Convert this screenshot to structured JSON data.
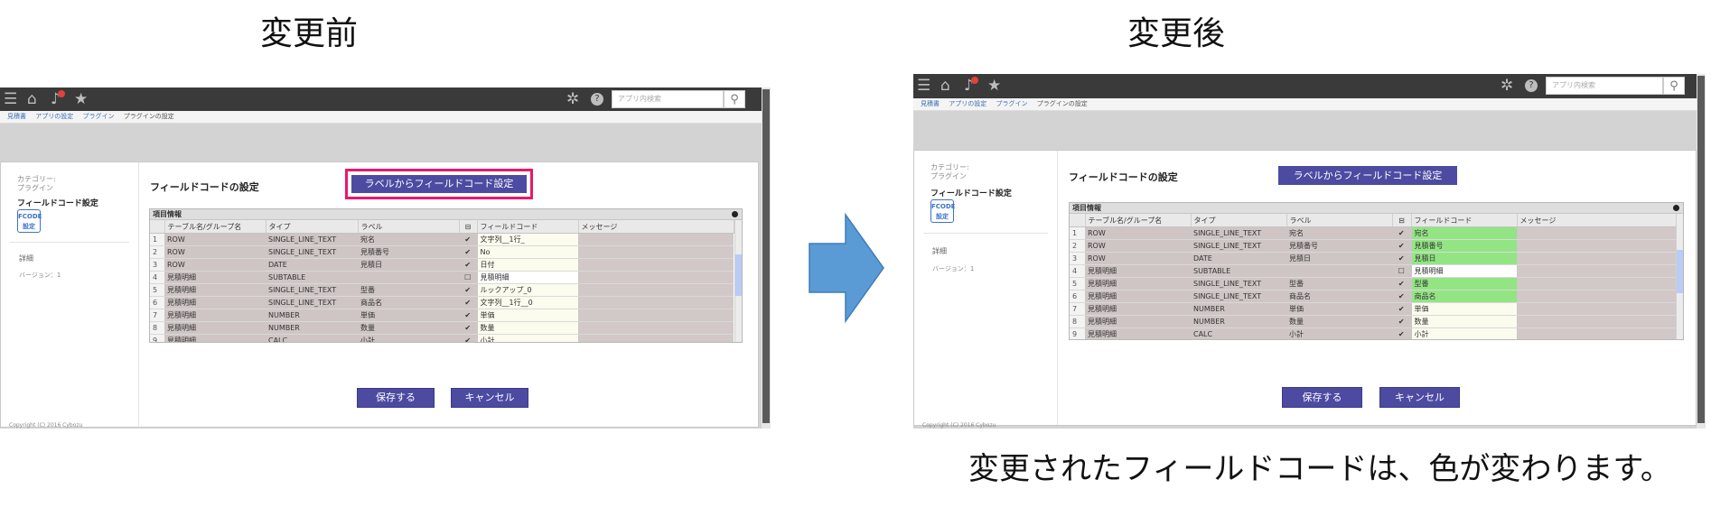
{
  "headings": {
    "before": "変更前",
    "after": "変更後"
  },
  "caption": "変更されたフィールドコードは、色が変わります。",
  "arrow": {
    "icon": "right-arrow",
    "color": "#5b9bd5"
  },
  "colors": {
    "changed_code": "#93e584",
    "highlight_outline": "#e8186d",
    "button": "#4c4ba1"
  },
  "app": {
    "search_placeholder": "アプリ内検索",
    "icons": [
      "menu-icon",
      "home-icon",
      "bell-icon",
      "star-icon",
      "gear-icon",
      "help-icon",
      "search-icon"
    ],
    "breadcrumb": [
      "見積書",
      "アプリの設定",
      "プラグイン",
      "プラグインの設定"
    ],
    "sidebar": {
      "category_label": "カテゴリー:",
      "category_value": "プラグイン",
      "title": "フィールドコード設定",
      "logo_line1": "FCODE",
      "logo_line2": "設定",
      "details": "詳細",
      "version": "バージョン：1"
    },
    "section_title": "フィールドコードの設定",
    "label_button": "ラベルからフィールドコード設定",
    "grid_title": "項目情報",
    "columns": [
      "",
      "テーブル名/グループ名",
      "タイプ",
      "ラベル",
      "⊟",
      "フィールドコード",
      "メッセージ"
    ],
    "rows_before": [
      {
        "no": "1",
        "table": "ROW",
        "type": "SINGLE_LINE_TEXT",
        "label": "宛名",
        "checked": true,
        "code": "文字列__1行_",
        "style": ""
      },
      {
        "no": "2",
        "table": "ROW",
        "type": "SINGLE_LINE_TEXT",
        "label": "見積番号",
        "checked": true,
        "code": "No",
        "style": ""
      },
      {
        "no": "3",
        "table": "ROW",
        "type": "DATE",
        "label": "見積日",
        "checked": true,
        "code": "日付",
        "style": ""
      },
      {
        "no": "4",
        "table": "見積明細",
        "type": "SUBTABLE",
        "label": "",
        "checked": false,
        "code": "見積明細",
        "style": "white"
      },
      {
        "no": "5",
        "table": "見積明細",
        "type": "SINGLE_LINE_TEXT",
        "label": "型番",
        "checked": true,
        "code": "ルックアップ_0",
        "style": ""
      },
      {
        "no": "6",
        "table": "見積明細",
        "type": "SINGLE_LINE_TEXT",
        "label": "商品名",
        "checked": true,
        "code": "文字列__1行__0",
        "style": ""
      },
      {
        "no": "7",
        "table": "見積明細",
        "type": "NUMBER",
        "label": "単価",
        "checked": true,
        "code": "単価",
        "style": ""
      },
      {
        "no": "8",
        "table": "見積明細",
        "type": "NUMBER",
        "label": "数量",
        "checked": true,
        "code": "数量",
        "style": ""
      },
      {
        "no": "9",
        "table": "見積明細",
        "type": "CALC",
        "label": "小計",
        "checked": true,
        "code": "小計",
        "style": ""
      }
    ],
    "rows_after": [
      {
        "no": "1",
        "table": "ROW",
        "type": "SINGLE_LINE_TEXT",
        "label": "宛名",
        "checked": true,
        "code": "宛名",
        "style": "changed"
      },
      {
        "no": "2",
        "table": "ROW",
        "type": "SINGLE_LINE_TEXT",
        "label": "見積番号",
        "checked": true,
        "code": "見積番号",
        "style": "changed"
      },
      {
        "no": "3",
        "table": "ROW",
        "type": "DATE",
        "label": "見積日",
        "checked": true,
        "code": "見積日",
        "style": "changed"
      },
      {
        "no": "4",
        "table": "見積明細",
        "type": "SUBTABLE",
        "label": "",
        "checked": false,
        "code": "見積明細",
        "style": "white"
      },
      {
        "no": "5",
        "table": "見積明細",
        "type": "SINGLE_LINE_TEXT",
        "label": "型番",
        "checked": true,
        "code": "型番",
        "style": "changed"
      },
      {
        "no": "6",
        "table": "見積明細",
        "type": "SINGLE_LINE_TEXT",
        "label": "商品名",
        "checked": true,
        "code": "商品名",
        "style": "changed"
      },
      {
        "no": "7",
        "table": "見積明細",
        "type": "NUMBER",
        "label": "単価",
        "checked": true,
        "code": "単価",
        "style": ""
      },
      {
        "no": "8",
        "table": "見積明細",
        "type": "NUMBER",
        "label": "数量",
        "checked": true,
        "code": "数量",
        "style": ""
      },
      {
        "no": "9",
        "table": "見積明細",
        "type": "CALC",
        "label": "小計",
        "checked": true,
        "code": "小計",
        "style": ""
      }
    ],
    "save_button": "保存する",
    "cancel_button": "キャンセル",
    "copyright": "Copyright (C) 2016 Cybozu"
  }
}
